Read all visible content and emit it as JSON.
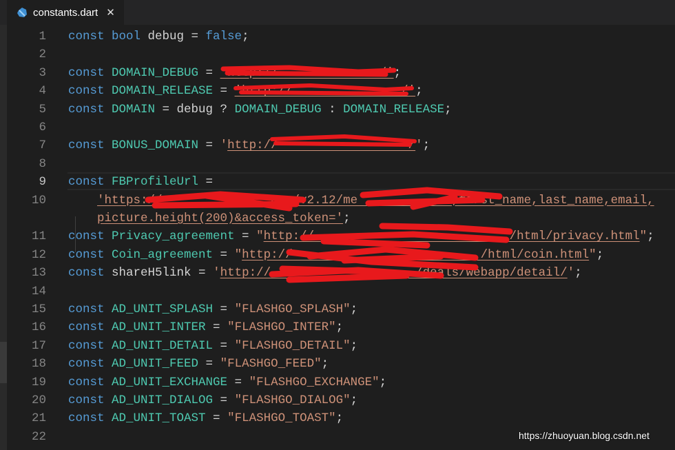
{
  "tab": {
    "label": "constants.dart",
    "close": "✕",
    "icon": "dart-icon"
  },
  "colors": {
    "keyword": "#569cd6",
    "type": "#4ec9b0",
    "string": "#ce9178",
    "text": "#d4d4d4",
    "redaction": "#e8191c"
  },
  "active_line": 9,
  "lines": [
    {
      "n": "1",
      "t": [
        [
          "const ",
          "kw"
        ],
        [
          "bool ",
          "kw"
        ],
        [
          "debug = ",
          "id"
        ],
        [
          "false",
          "kw"
        ],
        [
          ";",
          "op"
        ]
      ]
    },
    {
      "n": "2",
      "t": []
    },
    {
      "n": "3",
      "t": [
        [
          "const ",
          "kw"
        ],
        [
          "DOMAIN_DEBUG",
          "ty"
        ],
        [
          " = ",
          "op"
        ],
        [
          "'http://              /'",
          "link"
        ],
        [
          ";",
          "op"
        ]
      ]
    },
    {
      "n": "4",
      "t": [
        [
          "const ",
          "kw"
        ],
        [
          "DOMAIN_RELEASE",
          "ty"
        ],
        [
          " = ",
          "op"
        ],
        [
          "'http://               /'",
          "link"
        ],
        [
          ";",
          "op"
        ]
      ]
    },
    {
      "n": "5",
      "t": [
        [
          "const ",
          "kw"
        ],
        [
          "DOMAIN",
          "ty"
        ],
        [
          " = debug ? ",
          "op"
        ],
        [
          "DOMAIN_DEBUG",
          "ty"
        ],
        [
          " : ",
          "op"
        ],
        [
          "DOMAIN_RELEASE",
          "ty"
        ],
        [
          ";",
          "op"
        ]
      ]
    },
    {
      "n": "6",
      "t": []
    },
    {
      "n": "7",
      "t": [
        [
          "const ",
          "kw"
        ],
        [
          "BONUS_DOMAIN",
          "ty"
        ],
        [
          " = ",
          "op"
        ],
        [
          "'",
          "str"
        ],
        [
          "http://                  /",
          "link"
        ],
        [
          "'",
          "str"
        ],
        [
          ";",
          "op"
        ]
      ]
    },
    {
      "n": "8",
      "t": []
    },
    {
      "n": "9",
      "t": [
        [
          "const ",
          "kw"
        ],
        [
          "FBProfileUrl",
          "ty"
        ],
        [
          " =",
          "op"
        ]
      ]
    },
    {
      "n": "10",
      "t": [
        [
          "    ",
          "op"
        ],
        [
          "'https://               com/v2.12/me             ,first_name,last_name,email,",
          "link"
        ]
      ]
    },
    {
      "n": "",
      "t": [
        [
          "    ",
          "op"
        ],
        [
          "picture.height(200)&access_token='",
          "link"
        ],
        [
          ";",
          "op"
        ]
      ]
    },
    {
      "n": "11",
      "t": [
        [
          "const ",
          "kw"
        ],
        [
          "Privacy_agreement",
          "ty"
        ],
        [
          " = ",
          "op"
        ],
        [
          "\"",
          "str"
        ],
        [
          "http://                           /html/privacy.html",
          "link"
        ],
        [
          "\"",
          "str"
        ],
        [
          ";",
          "op"
        ]
      ]
    },
    {
      "n": "12",
      "t": [
        [
          "const ",
          "kw"
        ],
        [
          "Coin_agreement",
          "ty"
        ],
        [
          " = ",
          "op"
        ],
        [
          "\"",
          "str"
        ],
        [
          "http://                          /html/coin.html",
          "link"
        ],
        [
          "\"",
          "str"
        ],
        [
          ";",
          "op"
        ]
      ]
    },
    {
      "n": "13",
      "t": [
        [
          "const ",
          "kw"
        ],
        [
          "shareH5link",
          "id"
        ],
        [
          " = ",
          "op"
        ],
        [
          "'",
          "str"
        ],
        [
          "http://                    /deals/webapp/detail/",
          "link"
        ],
        [
          "'",
          "str"
        ],
        [
          ";",
          "op"
        ]
      ]
    },
    {
      "n": "14",
      "t": []
    },
    {
      "n": "15",
      "t": [
        [
          "const ",
          "kw"
        ],
        [
          "AD_UNIT_SPLASH",
          "ty"
        ],
        [
          " = ",
          "op"
        ],
        [
          "\"FLASHGO_SPLASH\"",
          "str"
        ],
        [
          ";",
          "op"
        ]
      ]
    },
    {
      "n": "16",
      "t": [
        [
          "const ",
          "kw"
        ],
        [
          "AD_UNIT_INTER",
          "ty"
        ],
        [
          " = ",
          "op"
        ],
        [
          "\"FLASHGO_INTER\"",
          "str"
        ],
        [
          ";",
          "op"
        ]
      ]
    },
    {
      "n": "17",
      "t": [
        [
          "const ",
          "kw"
        ],
        [
          "AD_UNIT_DETAIL",
          "ty"
        ],
        [
          " = ",
          "op"
        ],
        [
          "\"FLASHGO_DETAIL\"",
          "str"
        ],
        [
          ";",
          "op"
        ]
      ]
    },
    {
      "n": "18",
      "t": [
        [
          "const ",
          "kw"
        ],
        [
          "AD_UNIT_FEED",
          "ty"
        ],
        [
          " = ",
          "op"
        ],
        [
          "\"FLASHGO_FEED\"",
          "str"
        ],
        [
          ";",
          "op"
        ]
      ]
    },
    {
      "n": "19",
      "t": [
        [
          "const ",
          "kw"
        ],
        [
          "AD_UNIT_EXCHANGE",
          "ty"
        ],
        [
          " = ",
          "op"
        ],
        [
          "\"FLASHGO_EXCHANGE\"",
          "str"
        ],
        [
          ";",
          "op"
        ]
      ]
    },
    {
      "n": "20",
      "t": [
        [
          "const ",
          "kw"
        ],
        [
          "AD_UNIT_DIALOG",
          "ty"
        ],
        [
          " = ",
          "op"
        ],
        [
          "\"FLASHGO_DIALOG\"",
          "str"
        ],
        [
          ";",
          "op"
        ]
      ]
    },
    {
      "n": "21",
      "t": [
        [
          "const ",
          "kw"
        ],
        [
          "AD_UNIT_TOAST",
          "ty"
        ],
        [
          " = ",
          "op"
        ],
        [
          "\"FLASHGO_TOAST\"",
          "str"
        ],
        [
          ";",
          "op"
        ]
      ]
    },
    {
      "n": "22",
      "t": []
    }
  ],
  "watermark": "https://zhuoyuan.blog.csdn.net"
}
